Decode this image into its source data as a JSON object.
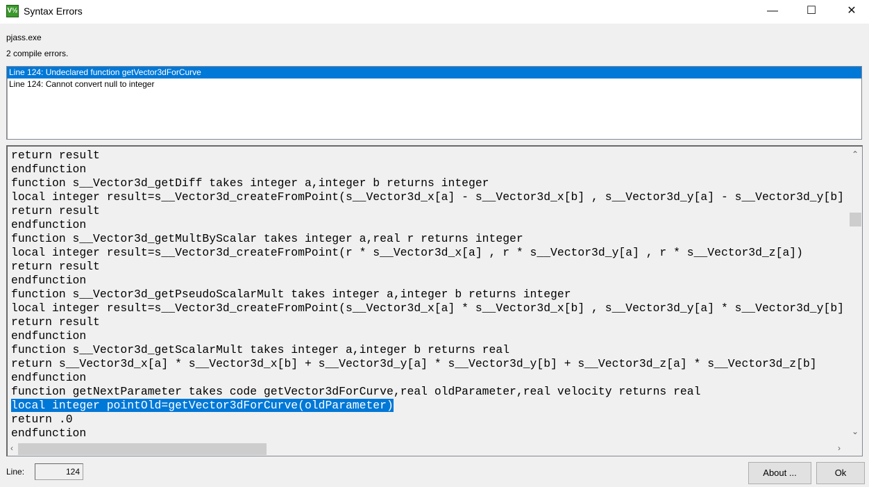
{
  "window": {
    "title": "Syntax Errors",
    "icon_text": "V½",
    "minimize": "—",
    "maximize": "☐",
    "close": "✕"
  },
  "tool": "pjass.exe",
  "summary": "2 compile errors.",
  "errors": [
    "Line 124:  Undeclared function getVector3dForCurve",
    "Line 124:  Cannot convert null to integer"
  ],
  "code_lines": [
    "return result",
    "endfunction",
    "function s__Vector3d_getDiff takes integer a,integer b returns integer",
    "local integer result=s__Vector3d_createFromPoint(s__Vector3d_x[a] - s__Vector3d_x[b] , s__Vector3d_y[a] - s__Vector3d_y[b]",
    "return result",
    "endfunction",
    "function s__Vector3d_getMultByScalar takes integer a,real r returns integer",
    "local integer result=s__Vector3d_createFromPoint(r * s__Vector3d_x[a] , r * s__Vector3d_y[a] , r * s__Vector3d_z[a])",
    "return result",
    "endfunction",
    "function s__Vector3d_getPseudoScalarMult takes integer a,integer b returns integer",
    "local integer result=s__Vector3d_createFromPoint(s__Vector3d_x[a] * s__Vector3d_x[b] , s__Vector3d_y[a] * s__Vector3d_y[b]",
    "return result",
    "endfunction",
    "function s__Vector3d_getScalarMult takes integer a,integer b returns real",
    "return s__Vector3d_x[a] * s__Vector3d_x[b] + s__Vector3d_y[a] * s__Vector3d_y[b] + s__Vector3d_z[a] * s__Vector3d_z[b]",
    "endfunction",
    "function getNextParameter takes code getVector3dForCurve,real oldParameter,real velocity returns real",
    "local integer pointOld=getVector3dForCurve(oldParameter)",
    "return .0",
    "endfunction"
  ],
  "selected_code_line_index": 18,
  "footer": {
    "line_label": "Line:",
    "line_value": "124",
    "about": "About ...",
    "ok": "Ok"
  },
  "colors": {
    "selection": "#0078d7"
  }
}
